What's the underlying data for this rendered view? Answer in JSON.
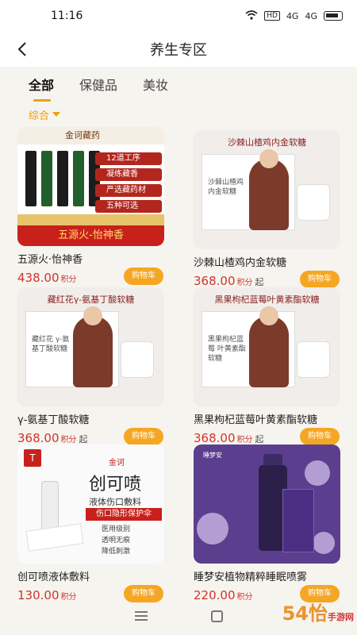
{
  "status": {
    "time": "11:16",
    "signal1": "4G",
    "signal2": "4G",
    "hd": "HD"
  },
  "header": {
    "title": "养生专区"
  },
  "tabs": [
    {
      "label": "全部"
    },
    {
      "label": "保健品"
    },
    {
      "label": "美妆"
    }
  ],
  "sort": {
    "label": "综合"
  },
  "colors": {
    "accent": "#f0a000",
    "price": "#d0342c",
    "cart": "#f5a623"
  },
  "products": [
    {
      "name": "五源火·怡神香",
      "price": "438.00",
      "unit": "积分",
      "suffix": "",
      "cart": "购物车",
      "image": {
        "brand": "金诃藏药",
        "features": [
          "12道工序",
          "凝练藏香",
          "严选藏药材",
          "五种可选"
        ],
        "banner": "五源火-怡神香"
      }
    },
    {
      "name": "沙棘山楂鸡内金软糖",
      "price": "368.00",
      "unit": "积分",
      "suffix": "起",
      "cart": "购物车",
      "image": {
        "title": "沙棘山楂鸡内金软糖",
        "boxtext": "沙棘山楂鸡内金软糖"
      }
    },
    {
      "name": "γ-氨基丁酸软糖",
      "price": "368.00",
      "unit": "积分",
      "suffix": "起",
      "cart": "购物车",
      "image": {
        "title": "藏红花γ-氨基丁酸软糖",
        "boxtext": "藏红花 γ-氨基丁酸软糖"
      }
    },
    {
      "name": "黑果枸杞蓝莓叶黄素酯软糖",
      "price": "368.00",
      "unit": "积分",
      "suffix": "起",
      "cart": "购物车",
      "image": {
        "title": "黑果枸杞蓝莓叶黄素酯软糖",
        "boxtext": "黑果枸杞蓝莓 叶黄素酯软糖"
      }
    },
    {
      "name": "创可喷液体敷料",
      "price": "130.00",
      "unit": "积分",
      "suffix": "",
      "cart": "购物车",
      "image": {
        "logo": "T",
        "brand": "金诃",
        "title": "创可喷",
        "sub": "液体伤口敷料",
        "ribbon": "伤口隐形保护伞",
        "features": [
          "医用级别",
          "透明无痕",
          "降低刺激"
        ]
      }
    },
    {
      "name": "睡梦安植物精粹睡眠喷雾",
      "price": "220.00",
      "unit": "积分",
      "suffix": "",
      "cart": "购物车",
      "image": {
        "text": "睡梦安"
      }
    }
  ],
  "watermark": {
    "main": "54怡",
    "small": "手游网"
  }
}
